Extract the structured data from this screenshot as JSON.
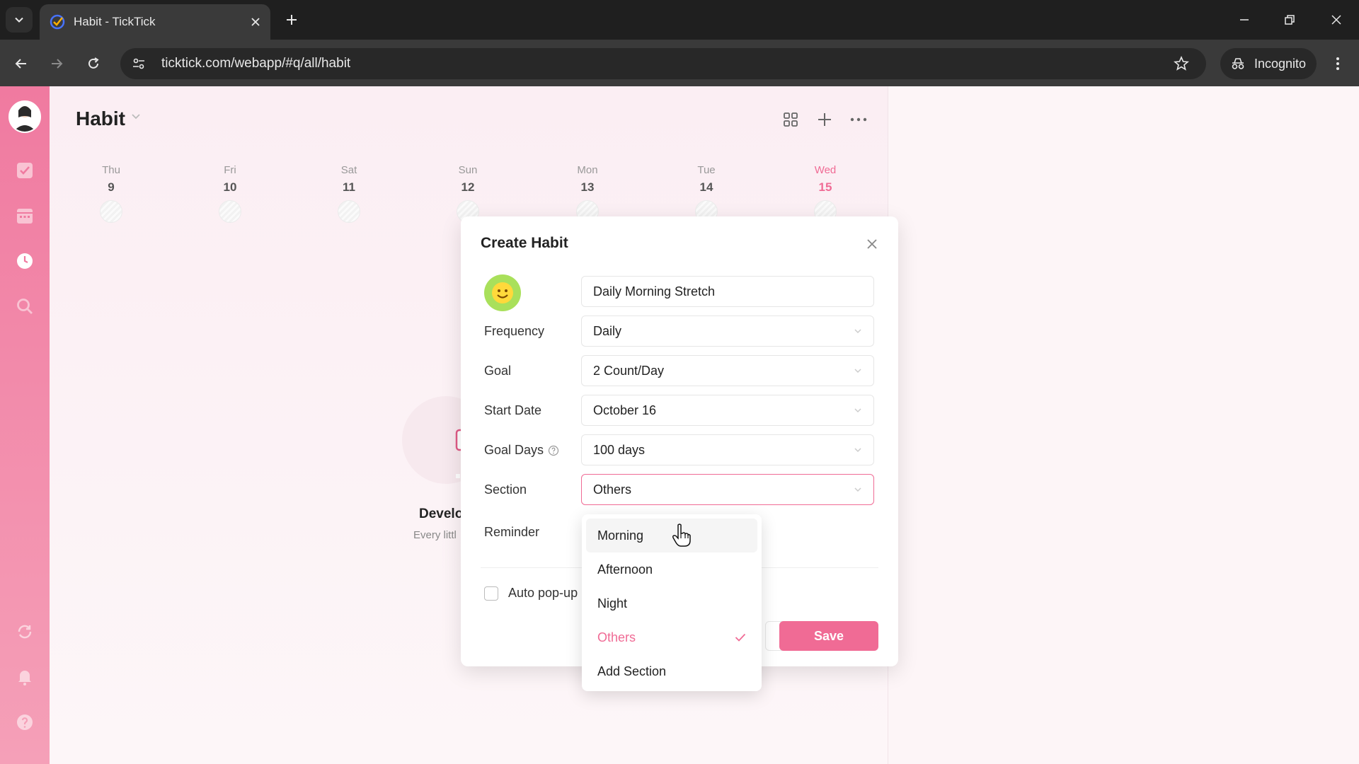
{
  "browser": {
    "tab_title": "Habit - TickTick",
    "url": "ticktick.com/webapp/#q/all/habit",
    "incognito_label": "Incognito"
  },
  "page": {
    "title": "Habit"
  },
  "week": [
    {
      "name": "Thu",
      "num": "9"
    },
    {
      "name": "Fri",
      "num": "10"
    },
    {
      "name": "Sat",
      "num": "11"
    },
    {
      "name": "Sun",
      "num": "12"
    },
    {
      "name": "Mon",
      "num": "13"
    },
    {
      "name": "Tue",
      "num": "14"
    },
    {
      "name": "Wed",
      "num": "15",
      "today": true
    }
  ],
  "empty_state": {
    "title": "Develo",
    "subtitle": "Every littl"
  },
  "dialog": {
    "title": "Create Habit",
    "name_value": "Daily Morning Stretch",
    "fields": {
      "frequency": {
        "label": "Frequency",
        "value": "Daily"
      },
      "goal": {
        "label": "Goal",
        "value": "2 Count/Day"
      },
      "start_date": {
        "label": "Start Date",
        "value": "October 16"
      },
      "goal_days": {
        "label": "Goal Days",
        "value": "100 days"
      },
      "section": {
        "label": "Section",
        "value": "Others"
      },
      "reminder": {
        "label": "Reminder"
      }
    },
    "auto_popup_label": "Auto pop-up",
    "save_label": "Save"
  },
  "section_dropdown": {
    "options": [
      {
        "label": "Morning",
        "state": "hover"
      },
      {
        "label": "Afternoon"
      },
      {
        "label": "Night"
      },
      {
        "label": "Others",
        "state": "selected"
      },
      {
        "label": "Add Section"
      }
    ]
  },
  "colors": {
    "accent": "#f06b95",
    "sidebar_top": "#f07aa0",
    "sidebar_bottom": "#f5a0b8",
    "habit_icon": "#a9e05b"
  }
}
